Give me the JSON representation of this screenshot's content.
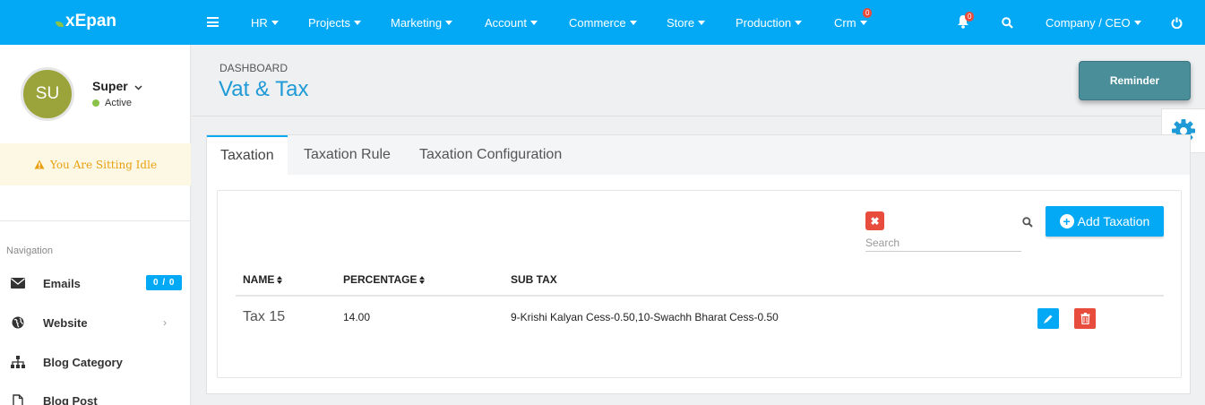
{
  "topbar": {
    "logo": "xEpan",
    "menu": [
      {
        "label": "HR"
      },
      {
        "label": "Projects"
      },
      {
        "label": "Marketing"
      },
      {
        "label": "Account"
      },
      {
        "label": "Commerce"
      },
      {
        "label": "Store"
      },
      {
        "label": "Production"
      },
      {
        "label": "Crm",
        "badge": "0"
      }
    ],
    "notifications_badge": "0",
    "company_menu": "Company / CEO"
  },
  "user": {
    "initials": "SU",
    "name": "Super",
    "status": "Active"
  },
  "idle_message": "You Are Sitting Idle",
  "navigation": {
    "label": "Navigation",
    "items": [
      {
        "label": "Emails",
        "badge": "0 / 0",
        "icon": "envelope-icon"
      },
      {
        "label": "Website",
        "icon": "globe-icon"
      },
      {
        "label": "Blog Category",
        "icon": "sitemap-icon"
      },
      {
        "label": "Blog Post",
        "icon": "file-icon"
      }
    ]
  },
  "page": {
    "breadcrumb": "DASHBOARD",
    "title": "Vat & Tax",
    "reminder_label": "Reminder"
  },
  "tabs": [
    {
      "label": "Taxation",
      "active": true
    },
    {
      "label": "Taxation Rule",
      "active": false
    },
    {
      "label": "Taxation Configuration",
      "active": false
    }
  ],
  "grid": {
    "search_placeholder": "Search",
    "add_label": "Add Taxation",
    "columns": [
      "NAME",
      "PERCENTAGE",
      "SUB TAX"
    ],
    "rows": [
      {
        "name": "Tax 15",
        "percentage": "14.00",
        "sub_tax": "9-Krishi Kalyan Cess-0.50,10-Swachh Bharat Cess-0.50"
      }
    ]
  },
  "colors": {
    "primary": "#03a9f4",
    "danger": "#e74c3c",
    "title": "#1e9ad6",
    "reminder": "#4a8e9a",
    "avatar": "#9ba33b",
    "active_dot": "#8bc34a",
    "idle_text": "#e8a012"
  }
}
